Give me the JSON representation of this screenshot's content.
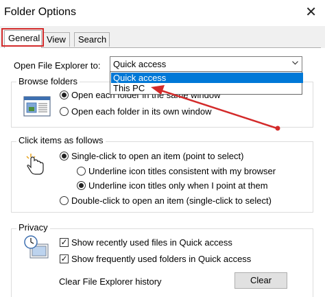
{
  "window": {
    "title": "Folder Options"
  },
  "tabs": [
    {
      "label": "General",
      "active": true
    },
    {
      "label": "View"
    },
    {
      "label": "Search"
    }
  ],
  "explorer": {
    "label": "Open File Explorer to:",
    "selected": "Quick access",
    "options": [
      "Quick access",
      "This PC"
    ],
    "highlighted_option": "Quick access"
  },
  "browse_folders": {
    "title": "Browse folders",
    "options": [
      {
        "label": "Open each folder in the same window",
        "checked": true
      },
      {
        "label": "Open each folder in its own window",
        "checked": false
      }
    ]
  },
  "click_items": {
    "title": "Click items as follows",
    "single_click": {
      "label": "Single-click to open an item (point to select)",
      "checked": true
    },
    "underline_browser": {
      "label": "Underline icon titles consistent with my browser",
      "checked": false
    },
    "underline_point": {
      "label": "Underline icon titles only when I point at them",
      "checked": true
    },
    "double_click": {
      "label": "Double-click to open an item (single-click to select)",
      "checked": false
    }
  },
  "privacy": {
    "title": "Privacy",
    "recent_files": {
      "label": "Show recently used files in Quick access",
      "checked": true
    },
    "frequent_folders": {
      "label": "Show frequently used folders in Quick access",
      "checked": true
    },
    "clear_label": "Clear File Explorer history",
    "clear_button": "Clear"
  },
  "colors": {
    "annotation_red": "#d32a2a",
    "selection_blue": "#0078d7"
  },
  "icons": [
    "close-icon",
    "chevron-down-icon",
    "window-icon",
    "hand-pointer-icon",
    "privacy-icon"
  ]
}
